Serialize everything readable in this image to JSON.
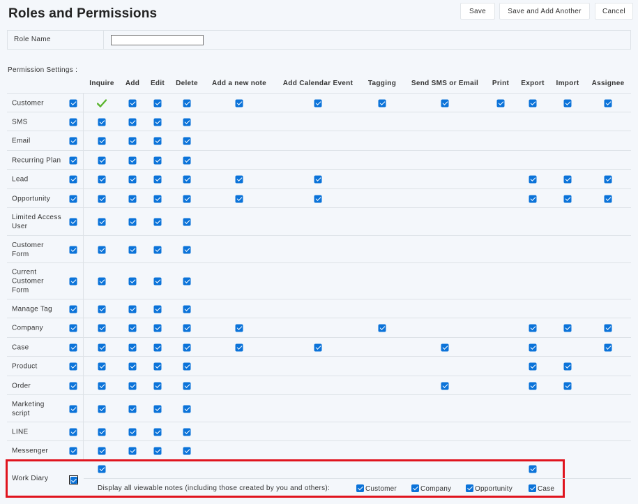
{
  "header": {
    "title": "Roles and Permissions"
  },
  "toolbar": {
    "save": "Save",
    "save_add": "Save and Add Another",
    "cancel": "Cancel"
  },
  "role": {
    "label": "Role Name",
    "value": ""
  },
  "permissions": {
    "label": "Permission Settings :",
    "columns": [
      "Inquire",
      "Add",
      "Edit",
      "Delete",
      "Add a new note",
      "Add Calendar Event",
      "Tagging",
      "Send SMS or Email",
      "Print",
      "Export",
      "Import",
      "Assignee"
    ],
    "rows": [
      {
        "name": "Customer",
        "checked": [
          1,
          1,
          1,
          1,
          1,
          1,
          1,
          1,
          1,
          1,
          1,
          1
        ],
        "inquire_style": "check"
      },
      {
        "name": "SMS",
        "checked": [
          1,
          1,
          1,
          1,
          0,
          0,
          0,
          0,
          0,
          0,
          0,
          0
        ]
      },
      {
        "name": "Email",
        "checked": [
          1,
          1,
          1,
          1,
          0,
          0,
          0,
          0,
          0,
          0,
          0,
          0
        ]
      },
      {
        "name": "Recurring Plan",
        "checked": [
          1,
          1,
          1,
          1,
          0,
          0,
          0,
          0,
          0,
          0,
          0,
          0
        ]
      },
      {
        "name": "Lead",
        "checked": [
          1,
          1,
          1,
          1,
          1,
          1,
          0,
          0,
          0,
          1,
          1,
          1
        ]
      },
      {
        "name": "Opportunity",
        "checked": [
          1,
          1,
          1,
          1,
          1,
          1,
          0,
          0,
          0,
          1,
          1,
          1
        ]
      },
      {
        "name": "Limited Access User",
        "checked": [
          1,
          1,
          1,
          1,
          0,
          0,
          0,
          0,
          0,
          0,
          0,
          0
        ]
      },
      {
        "name": "Customer Form",
        "checked": [
          1,
          1,
          1,
          1,
          0,
          0,
          0,
          0,
          0,
          0,
          0,
          0
        ]
      },
      {
        "name": "Current Customer Form",
        "checked": [
          1,
          1,
          1,
          1,
          0,
          0,
          0,
          0,
          0,
          0,
          0,
          0
        ]
      },
      {
        "name": "Manage Tag",
        "checked": [
          1,
          1,
          1,
          1,
          0,
          0,
          0,
          0,
          0,
          0,
          0,
          0
        ]
      },
      {
        "name": "Company",
        "checked": [
          1,
          1,
          1,
          1,
          1,
          0,
          1,
          0,
          0,
          1,
          1,
          1
        ]
      },
      {
        "name": "Case",
        "checked": [
          1,
          1,
          1,
          1,
          1,
          1,
          0,
          1,
          0,
          1,
          0,
          1
        ]
      },
      {
        "name": "Product",
        "checked": [
          1,
          1,
          1,
          1,
          0,
          0,
          0,
          0,
          0,
          1,
          1,
          0
        ]
      },
      {
        "name": "Order",
        "checked": [
          1,
          1,
          1,
          1,
          0,
          0,
          0,
          1,
          0,
          1,
          1,
          0
        ]
      },
      {
        "name": "Marketing script",
        "checked": [
          1,
          1,
          1,
          1,
          0,
          0,
          0,
          0,
          0,
          0,
          0,
          0
        ]
      },
      {
        "name": "LINE",
        "checked": [
          1,
          1,
          1,
          1,
          0,
          0,
          0,
          0,
          0,
          0,
          0,
          0
        ]
      },
      {
        "name": "Messenger",
        "checked": [
          1,
          1,
          1,
          1,
          0,
          0,
          0,
          0,
          0,
          0,
          0,
          0
        ]
      }
    ]
  },
  "work_diary": {
    "name": "Work Diary",
    "checked": [
      1,
      0,
      0,
      0,
      0,
      0,
      0,
      0,
      0,
      1,
      0,
      0
    ],
    "notes_label": "Display all viewable notes (including those created by you and others):",
    "options": [
      "Customer",
      "Company",
      "Opportunity",
      "Case"
    ]
  },
  "colors": {
    "accent": "#0b73d9",
    "highlight": "#e0141e",
    "inquire_check": "#5bb52f"
  }
}
